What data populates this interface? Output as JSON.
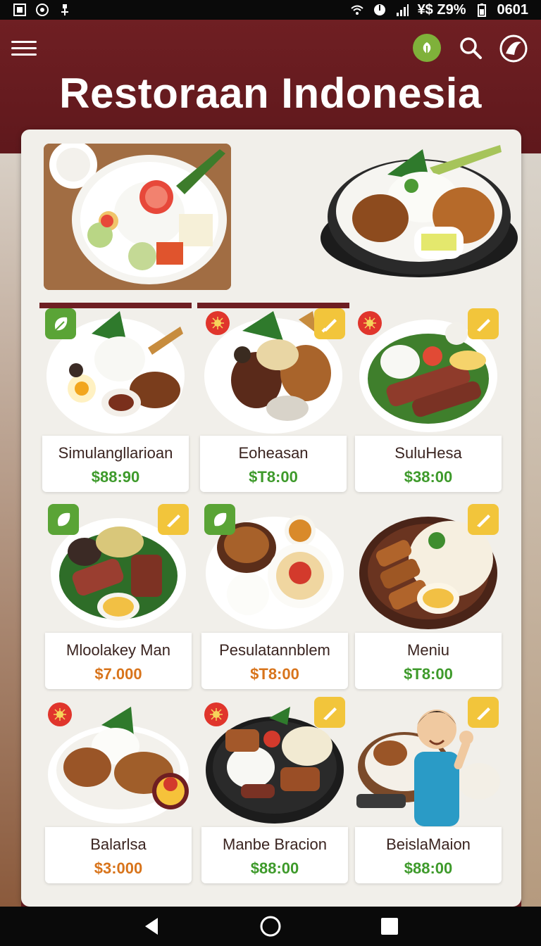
{
  "status_bar": {
    "right_text": "¥$ Z9%",
    "time": "0601"
  },
  "header": {
    "title": "Restoraan Indonesia",
    "icons": [
      "menu-icon",
      "leaf-icon",
      "search-icon",
      "restaurant-logo-icon"
    ]
  },
  "menu": {
    "dishes": [
      {
        "name": "Simulangllarioan",
        "price": "$88:90",
        "price_color": "#3e9a2b",
        "badge": "leaf-icon",
        "selected": true
      },
      {
        "name": "Eoheasan",
        "price": "$T8:00",
        "price_color": "#3e9a2b",
        "badge": "chili-icon",
        "selected": true
      },
      {
        "name": "SuluHesa",
        "price": "$38:00",
        "price_color": "#3e9a2b",
        "badge": "chili-icon",
        "selected": false
      },
      {
        "name": "Mloolakey Man",
        "price": "$7.000",
        "price_color": "#d8741b",
        "badge": "leaf-icon",
        "selected": false
      },
      {
        "name": "Pesulatannblem",
        "price": "$T8:00",
        "price_color": "#d8741b",
        "badge": "leaf-icon",
        "selected": false
      },
      {
        "name": "Meniu",
        "price": "$T8:00",
        "price_color": "#3e9a2b",
        "badge": "chef-knife-icon",
        "selected": false
      },
      {
        "name": "Balarlsa",
        "price": "$3:000",
        "price_color": "#d8741b",
        "badge": "chili-icon",
        "selected": false
      },
      {
        "name": "Manbe Bracion",
        "price": "$88:00",
        "price_color": "#3e9a2b",
        "badge": "chili-icon",
        "selected": false
      },
      {
        "name": "BeislaMaion",
        "price": "$88:00",
        "price_color": "#3e9a2b",
        "badge": "chef-knife-icon",
        "selected": false
      }
    ]
  },
  "nav_bar": {
    "buttons": [
      "back-icon",
      "home-icon",
      "recents-icon"
    ]
  }
}
